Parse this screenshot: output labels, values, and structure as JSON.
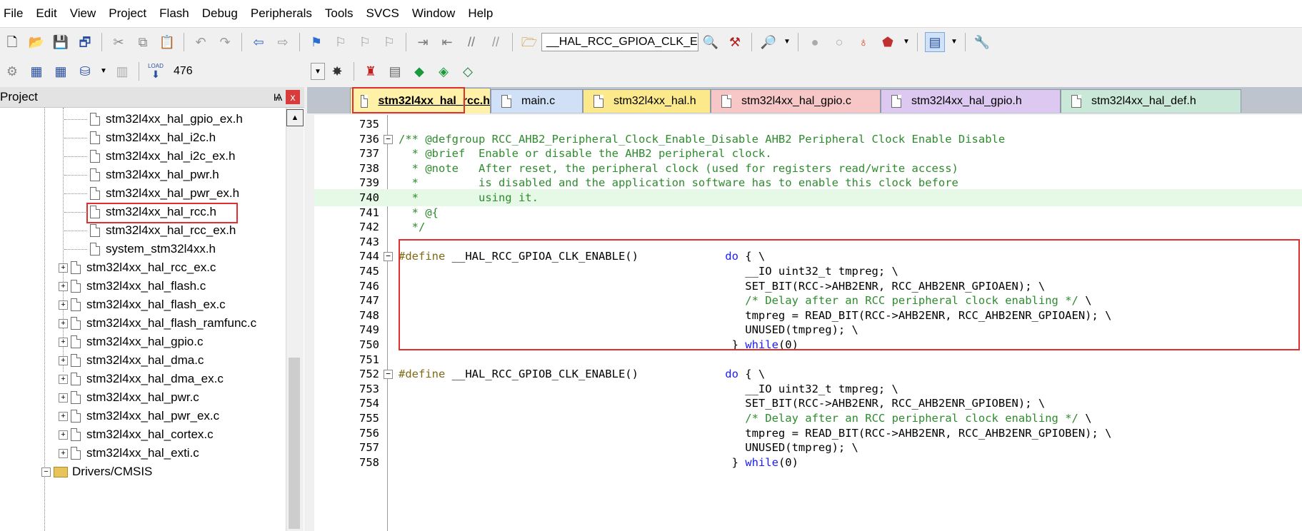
{
  "menu": [
    "File",
    "Edit",
    "View",
    "Project",
    "Flash",
    "Debug",
    "Peripherals",
    "Tools",
    "SVCS",
    "Window",
    "Help"
  ],
  "toolbar1": {
    "combo_text": "__HAL_RCC_GPIOA_CLK_E"
  },
  "toolbar2": {
    "load_text": "LOAD",
    "combo_text": "476"
  },
  "project_panel": {
    "title": "Project",
    "pin": "Ѩ",
    "close": "x",
    "tree": [
      {
        "label": "stm32l4xx_hal_gpio_ex.h",
        "kind": "file",
        "level": 2
      },
      {
        "label": "stm32l4xx_hal_i2c.h",
        "kind": "file",
        "level": 2
      },
      {
        "label": "stm32l4xx_hal_i2c_ex.h",
        "kind": "file",
        "level": 2
      },
      {
        "label": "stm32l4xx_hal_pwr.h",
        "kind": "file",
        "level": 2
      },
      {
        "label": "stm32l4xx_hal_pwr_ex.h",
        "kind": "file",
        "level": 2
      },
      {
        "label": "stm32l4xx_hal_rcc.h",
        "kind": "file",
        "level": 2,
        "selected": true
      },
      {
        "label": "stm32l4xx_hal_rcc_ex.h",
        "kind": "file",
        "level": 2
      },
      {
        "label": "system_stm32l4xx.h",
        "kind": "file",
        "level": 2
      },
      {
        "label": "stm32l4xx_hal_rcc_ex.c",
        "kind": "source",
        "level": 1
      },
      {
        "label": "stm32l4xx_hal_flash.c",
        "kind": "source",
        "level": 1
      },
      {
        "label": "stm32l4xx_hal_flash_ex.c",
        "kind": "source",
        "level": 1
      },
      {
        "label": "stm32l4xx_hal_flash_ramfunc.c",
        "kind": "source",
        "level": 1
      },
      {
        "label": "stm32l4xx_hal_gpio.c",
        "kind": "source",
        "level": 1
      },
      {
        "label": "stm32l4xx_hal_dma.c",
        "kind": "source",
        "level": 1
      },
      {
        "label": "stm32l4xx_hal_dma_ex.c",
        "kind": "source",
        "level": 1
      },
      {
        "label": "stm32l4xx_hal_pwr.c",
        "kind": "source",
        "level": 1
      },
      {
        "label": "stm32l4xx_hal_pwr_ex.c",
        "kind": "source",
        "level": 1
      },
      {
        "label": "stm32l4xx_hal_cortex.c",
        "kind": "source",
        "level": 1
      },
      {
        "label": "stm32l4xx_hal_exti.c",
        "kind": "source",
        "level": 1
      },
      {
        "label": "Drivers/CMSIS",
        "kind": "folder",
        "level": 0
      }
    ]
  },
  "tabs": [
    {
      "label": "stm32l4xx_hal_rcc.h",
      "color": "#fff1a8",
      "active": true
    },
    {
      "label": "main.c",
      "color": "#cfe0f7"
    },
    {
      "label": "stm32l4xx_hal.h",
      "color": "#fbe98c"
    },
    {
      "label": "stm32l4xx_hal_gpio.c",
      "color": "#f7c6c6"
    },
    {
      "label": "stm32l4xx_hal_gpio.h",
      "color": "#dcc8f0"
    },
    {
      "label": "stm32l4xx_hal_def.h",
      "color": "#c9e8d8"
    }
  ],
  "code_lines": [
    {
      "n": "735",
      "segs": []
    },
    {
      "n": "736",
      "fold": "-",
      "segs": [
        [
          "cm",
          "/** @defgroup RCC_AHB2_Peripheral_Clock_Enable_Disable AHB2 Peripheral Clock Enable Disable"
        ]
      ]
    },
    {
      "n": "737",
      "segs": [
        [
          "cm",
          "  * @brief  Enable or disable the AHB2 peripheral clock."
        ]
      ]
    },
    {
      "n": "738",
      "segs": [
        [
          "cm",
          "  * @note   After reset, the peripheral clock (used for registers read/write access)"
        ]
      ]
    },
    {
      "n": "739",
      "segs": [
        [
          "cm",
          "  *         is disabled and the application software has to enable this clock before"
        ]
      ]
    },
    {
      "n": "740",
      "hl": true,
      "segs": [
        [
          "cm",
          "  *         using it."
        ]
      ]
    },
    {
      "n": "741",
      "segs": [
        [
          "cm",
          "  * @{"
        ]
      ]
    },
    {
      "n": "742",
      "segs": [
        [
          "cm",
          "  */"
        ]
      ]
    },
    {
      "n": "743",
      "segs": []
    },
    {
      "n": "744",
      "fold": "-",
      "segs": [
        [
          "pp",
          "#define"
        ],
        [
          "nm",
          " __HAL_RCC_GPIOA_CLK_ENABLE()             "
        ],
        [
          "kw",
          "do"
        ],
        [
          "nm",
          " { \\"
        ]
      ]
    },
    {
      "n": "745",
      "segs": [
        [
          "nm",
          "                                                    __IO uint32_t tmpreg; \\"
        ]
      ]
    },
    {
      "n": "746",
      "segs": [
        [
          "nm",
          "                                                    SET_BIT(RCC->AHB2ENR, RCC_AHB2ENR_GPIOAEN); \\"
        ]
      ]
    },
    {
      "n": "747",
      "segs": [
        [
          "nm",
          "                                                    "
        ],
        [
          "cm",
          "/* Delay after an RCC peripheral clock enabling */"
        ],
        [
          "nm",
          " \\"
        ]
      ]
    },
    {
      "n": "748",
      "segs": [
        [
          "nm",
          "                                                    tmpreg = READ_BIT(RCC->AHB2ENR, RCC_AHB2ENR_GPIOAEN); \\"
        ]
      ]
    },
    {
      "n": "749",
      "segs": [
        [
          "nm",
          "                                                    UNUSED(tmpreg); \\"
        ]
      ]
    },
    {
      "n": "750",
      "segs": [
        [
          "nm",
          "                                                  } "
        ],
        [
          "kw",
          "while"
        ],
        [
          "nm",
          "(0)"
        ]
      ]
    },
    {
      "n": "751",
      "segs": []
    },
    {
      "n": "752",
      "fold": "-",
      "segs": [
        [
          "pp",
          "#define"
        ],
        [
          "nm",
          " __HAL_RCC_GPIOB_CLK_ENABLE()             "
        ],
        [
          "kw",
          "do"
        ],
        [
          "nm",
          " { \\"
        ]
      ]
    },
    {
      "n": "753",
      "segs": [
        [
          "nm",
          "                                                    __IO uint32_t tmpreg; \\"
        ]
      ]
    },
    {
      "n": "754",
      "segs": [
        [
          "nm",
          "                                                    SET_BIT(RCC->AHB2ENR, RCC_AHB2ENR_GPIOBEN); \\"
        ]
      ]
    },
    {
      "n": "755",
      "segs": [
        [
          "nm",
          "                                                    "
        ],
        [
          "cm",
          "/* Delay after an RCC peripheral clock enabling */"
        ],
        [
          "nm",
          " \\"
        ]
      ]
    },
    {
      "n": "756",
      "segs": [
        [
          "nm",
          "                                                    tmpreg = READ_BIT(RCC->AHB2ENR, RCC_AHB2ENR_GPIOBEN); \\"
        ]
      ]
    },
    {
      "n": "757",
      "segs": [
        [
          "nm",
          "                                                    UNUSED(tmpreg); \\"
        ]
      ]
    },
    {
      "n": "758",
      "segs": [
        [
          "nm",
          "                                                  } "
        ],
        [
          "kw",
          "while"
        ],
        [
          "nm",
          "(0)"
        ]
      ]
    }
  ]
}
